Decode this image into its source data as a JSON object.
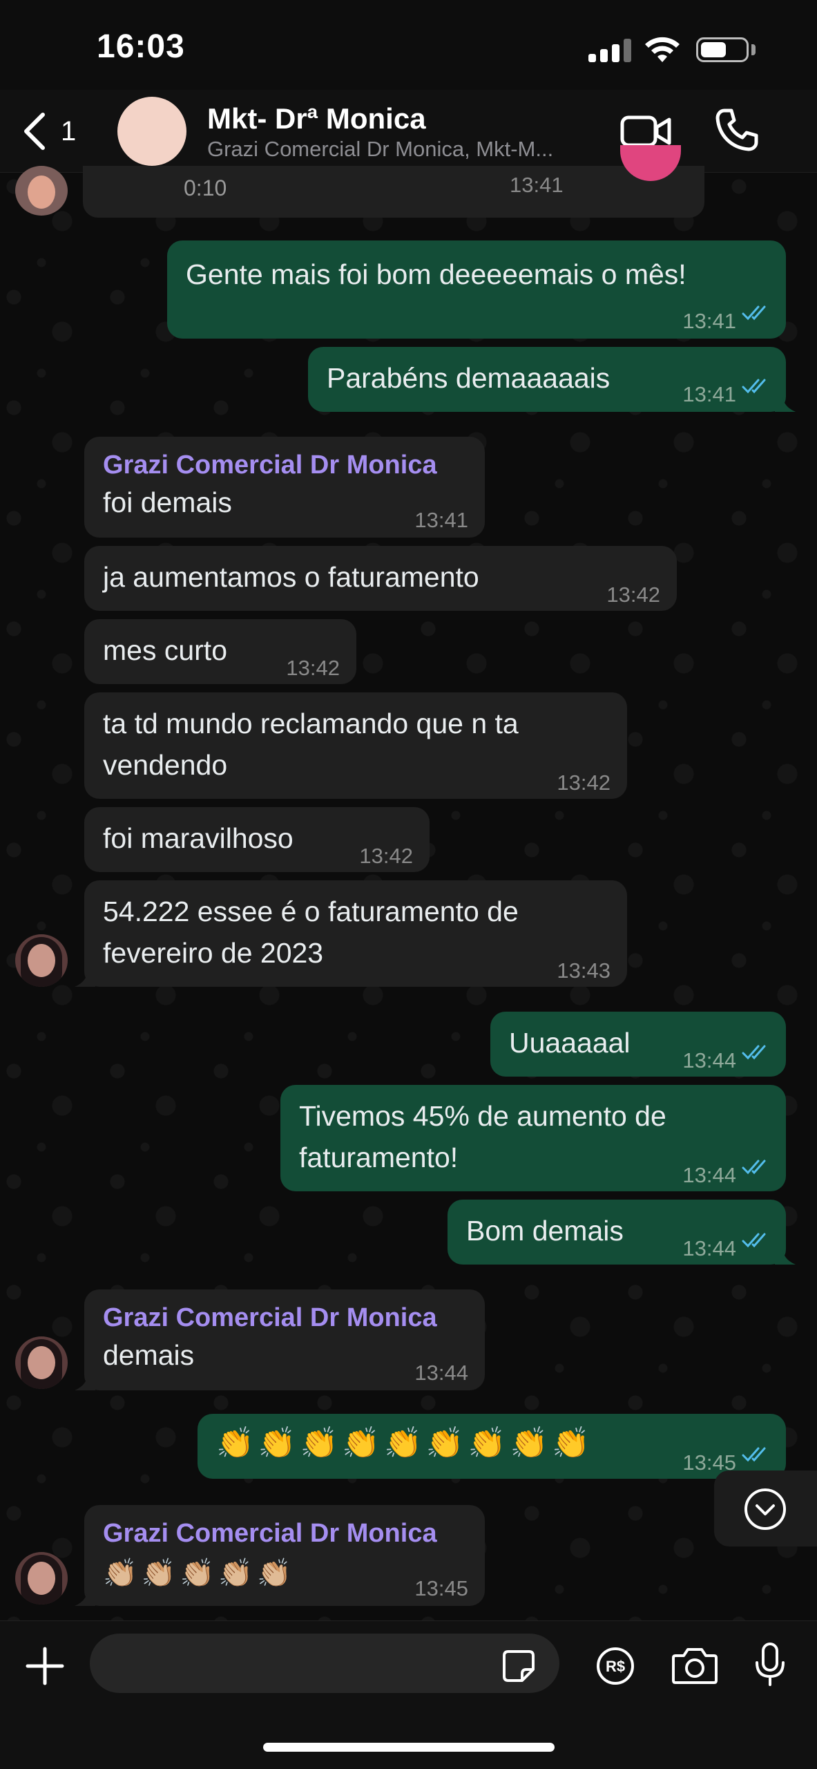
{
  "status_bar": {
    "time": "16:03"
  },
  "header": {
    "back_count": "1",
    "title": "Mkt- Drª Monica",
    "subtitle": "Grazi Comercial Dr Monica, Mkt-M..."
  },
  "voice_note": {
    "duration": "0:10",
    "time": "13:41"
  },
  "messages": [
    {
      "text": "Gente mais foi bom deeeeemais o mês!",
      "time": "13:41"
    },
    {
      "text": "Parabéns demaaaaais",
      "time": "13:41"
    },
    {
      "sender": "Grazi Comercial Dr Monica",
      "text": "foi demais",
      "time": "13:41"
    },
    {
      "text": "ja aumentamos o faturamento",
      "time": "13:42"
    },
    {
      "text": "mes curto",
      "time": "13:42"
    },
    {
      "text_line1": "ta td mundo reclamando que n ta",
      "text_line2": "vendendo",
      "time": "13:42"
    },
    {
      "text": "foi maravilhoso",
      "time": "13:42"
    },
    {
      "text_line1": "54.222 essee é o faturamento de",
      "text_line2": "fevereiro de 2023",
      "time": "13:43"
    },
    {
      "text": "Uuaaaaal",
      "time": "13:44"
    },
    {
      "text_line1": "Tivemos 45% de aumento de",
      "text_line2": "faturamento!",
      "time": "13:44"
    },
    {
      "text": "Bom demais",
      "time": "13:44"
    },
    {
      "sender": "Grazi Comercial Dr Monica",
      "text": "demais",
      "time": "13:44"
    },
    {
      "text": "👏👏👏👏👏👏👏👏👏",
      "time": "13:45"
    },
    {
      "sender": "Grazi Comercial Dr Monica",
      "text": "👏🏼👏🏼👏🏼👏🏼👏🏼",
      "time": "13:45"
    }
  ],
  "colors": {
    "outgoing_bubble": "#134d37",
    "incoming_bubble": "#202020",
    "sender_name": "#a58ef0",
    "read_ticks": "#53bdeb"
  }
}
